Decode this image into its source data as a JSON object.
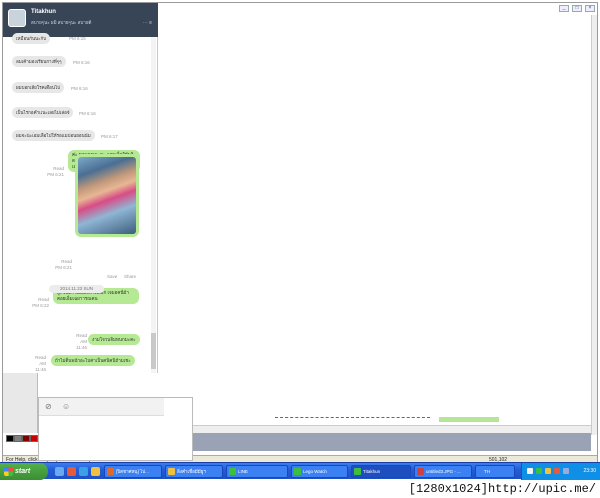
{
  "colors": {
    "chat_header": "#374556",
    "bubble_out": "#b5e993",
    "bubble_in": "#e7e7e7",
    "taskbar": "#235dd7",
    "start": "#3a8e33"
  },
  "chat": {
    "contact_name": "Titakhun",
    "status_message": "สบายๆนะ ผมิ สบายๆนะ สบายดี",
    "header_icons": "⋯ ≡",
    "messages": [
      {
        "dir": "in",
        "text": "เหมือนกันนะกับ",
        "time": "PM 6:15"
      },
      {
        "dir": "in",
        "text": "ลมเค้ามองเรียนกางพี่ๆๆ",
        "time": "PM 6:16"
      },
      {
        "dir": "in",
        "text": "ผมบอกเลียโรคเดือนไป",
        "time": "PM 6:16"
      },
      {
        "dir": "in",
        "text": "เป็นไรกอคำเเนะเลยไม่เล่อจั",
        "time": "PM 6:16"
      },
      {
        "dir": "in",
        "text": "ผมจะน่ะเ่อมเลือไปให้รอแมบ่อนยอนนัม",
        "time": "PM 6:17"
      },
      {
        "dir": "out",
        "text": "ค่ะ ขอบคุณนะคะ แหมเอ็ดให้พลิดเพ้าแพน้ไม่ใช่ชั้วย ข้อไม่ลดค่าเมมเลย",
        "read": "Read",
        "time": "PM 6:21"
      },
      {
        "dir": "out",
        "photo": true,
        "read": "Read",
        "time": "PM 6:21",
        "actions": [
          "Save",
          "Share"
        ]
      },
      {
        "dir": "out",
        "text": "ลูกชั่นลิก ผมมองทางเลือก เจมอคนี่ม้า คอยเอ็มเฉยาารณคน",
        "read": "Read",
        "time": "PM 6:22"
      },
      {
        "dir": "out",
        "text": "งามโจวนจิมทนกมะคะ",
        "read": "Read",
        "time": "AM 11:46"
      },
      {
        "dir": "out",
        "text": "ถ้าไม่ติ่นพน้าอะไปค่าเป็นคนิคนิถ้ามเชะ",
        "read": "Read",
        "time": "AM 11:46"
      }
    ],
    "date_separator": "2014.11.23 SUN",
    "input_icons": [
      "paperclip-icon",
      "emoji-icon"
    ]
  },
  "paint": {
    "status_help": "For Help, click Help Topics on the Help Menu.",
    "coords": "501,102",
    "palette": [
      "#000000",
      "#808080",
      "#800000",
      "#808000",
      "#ffffff",
      "#c0c0c0",
      "#ff0000",
      "#ffff00"
    ]
  },
  "taskbar": {
    "start_label": "start",
    "tasks": [
      {
        "label": "[ปิดชาศหนุ] ไป...",
        "color": "#e06a2c"
      },
      {
        "label": "สิ่งคำเชื่อมีมียูฯ",
        "color": "#f0c040"
      },
      {
        "label": "LINE",
        "color": "#3cbf3c"
      },
      {
        "label": "Lego Watch",
        "color": "#3cbf3c"
      },
      {
        "label": "Titakhun",
        "color": "#3cbf3c"
      },
      {
        "label": "untitled3.JPG - ...",
        "color": "#d04040"
      }
    ],
    "lang": "TH",
    "clock": "23:30"
  },
  "watermark": "[1280x1024]http://upic.me/"
}
